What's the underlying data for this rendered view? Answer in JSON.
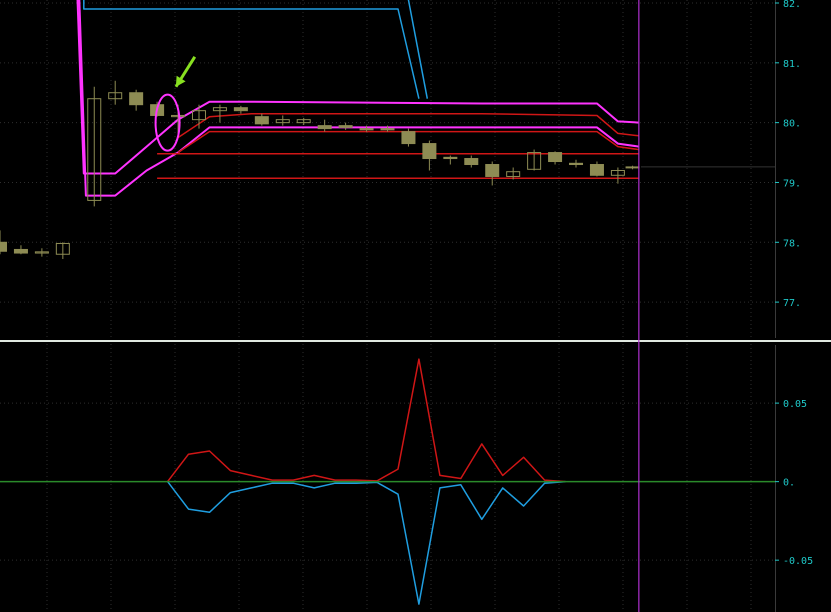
{
  "colors": {
    "background": "#000000",
    "grid": "#2e2e2e",
    "separator": "#e0e8e0",
    "axis_text": "#1fc9c9",
    "candle": "#8e8c54",
    "magenta": "#ff33ff",
    "red": "#d01616",
    "blue": "#1f9ee0",
    "zero_line": "#2a8a2a",
    "cursor": "#b030d0",
    "arrow": "#88e020",
    "ellipse": "#ff33ff"
  },
  "chart_data": [
    {
      "type": "candlestick",
      "panel": "price",
      "y_ticks": [
        "82.",
        "81.",
        "80.",
        "79.",
        "78.",
        "77."
      ],
      "y_tick_values": [
        82,
        81,
        80,
        79,
        78,
        77
      ],
      "ylim": [
        76.4,
        82.05
      ],
      "xlim": [
        0,
        37
      ],
      "candles": [
        {
          "x": 0,
          "o": 78.0,
          "h": 78.2,
          "l": 77.8,
          "c": 77.85
        },
        {
          "x": 1,
          "o": 77.88,
          "h": 77.95,
          "l": 77.8,
          "c": 77.82
        },
        {
          "x": 2,
          "o": 77.82,
          "h": 77.9,
          "l": 77.76,
          "c": 77.84
        },
        {
          "x": 3,
          "o": 77.8,
          "h": 78.0,
          "l": 77.72,
          "c": 77.98
        },
        {
          "x": 4.5,
          "o": 78.7,
          "h": 80.6,
          "l": 78.6,
          "c": 80.4
        },
        {
          "x": 5.5,
          "o": 80.4,
          "h": 80.7,
          "l": 80.3,
          "c": 80.5
        },
        {
          "x": 6.5,
          "o": 80.5,
          "h": 80.55,
          "l": 80.2,
          "c": 80.3
        },
        {
          "x": 7.5,
          "o": 80.3,
          "h": 80.35,
          "l": 80.1,
          "c": 80.12
        },
        {
          "x": 8.5,
          "o": 80.1,
          "h": 80.3,
          "l": 79.8,
          "c": 80.12
        },
        {
          "x": 9.5,
          "o": 80.05,
          "h": 80.3,
          "l": 79.9,
          "c": 80.2
        },
        {
          "x": 10.5,
          "o": 80.2,
          "h": 80.3,
          "l": 80.0,
          "c": 80.25
        },
        {
          "x": 11.5,
          "o": 80.25,
          "h": 80.28,
          "l": 80.15,
          "c": 80.2
        },
        {
          "x": 12.5,
          "o": 80.1,
          "h": 80.15,
          "l": 79.95,
          "c": 79.98
        },
        {
          "x": 13.5,
          "o": 80.0,
          "h": 80.12,
          "l": 79.95,
          "c": 80.05
        },
        {
          "x": 14.5,
          "o": 80.0,
          "h": 80.08,
          "l": 79.96,
          "c": 80.05
        },
        {
          "x": 15.5,
          "o": 79.95,
          "h": 80.05,
          "l": 79.85,
          "c": 79.9
        },
        {
          "x": 16.5,
          "o": 79.95,
          "h": 80.0,
          "l": 79.88,
          "c": 79.92
        },
        {
          "x": 17.5,
          "o": 79.9,
          "h": 79.95,
          "l": 79.85,
          "c": 79.88
        },
        {
          "x": 18.5,
          "o": 79.9,
          "h": 79.95,
          "l": 79.85,
          "c": 79.88
        },
        {
          "x": 19.5,
          "o": 79.85,
          "h": 79.9,
          "l": 79.6,
          "c": 79.65
        },
        {
          "x": 20.5,
          "o": 79.65,
          "h": 79.7,
          "l": 79.2,
          "c": 79.4
        },
        {
          "x": 21.5,
          "o": 79.42,
          "h": 79.45,
          "l": 79.3,
          "c": 79.4
        },
        {
          "x": 22.5,
          "o": 79.4,
          "h": 79.45,
          "l": 79.25,
          "c": 79.3
        },
        {
          "x": 23.5,
          "o": 79.3,
          "h": 79.35,
          "l": 78.95,
          "c": 79.1
        },
        {
          "x": 24.5,
          "o": 79.1,
          "h": 79.25,
          "l": 79.05,
          "c": 79.18
        },
        {
          "x": 25.5,
          "o": 79.22,
          "h": 79.55,
          "l": 79.2,
          "c": 79.5
        },
        {
          "x": 26.5,
          "o": 79.5,
          "h": 79.52,
          "l": 79.3,
          "c": 79.35
        },
        {
          "x": 27.5,
          "o": 79.32,
          "h": 79.38,
          "l": 79.25,
          "c": 79.3
        },
        {
          "x": 28.5,
          "o": 79.3,
          "h": 79.35,
          "l": 79.1,
          "c": 79.12
        },
        {
          "x": 29.5,
          "o": 79.12,
          "h": 79.25,
          "l": 78.98,
          "c": 79.2
        },
        {
          "x": 30.2,
          "o": 79.25,
          "h": 79.28,
          "l": 79.22,
          "c": 79.26
        }
      ],
      "series": [
        {
          "color_key": "magenta",
          "style": "band_top",
          "x": [
            -1,
            3.5,
            4.0,
            5.5,
            7.0,
            8.5,
            10.0,
            12.0,
            23.0,
            28.5,
            29.5,
            30.5
          ],
          "values": [
            88.0,
            84.0,
            79.15,
            79.15,
            79.6,
            80.05,
            80.35,
            80.35,
            80.32,
            80.32,
            80.02,
            80.0
          ]
        },
        {
          "color_key": "magenta",
          "style": "band_bottom",
          "x": [
            -1,
            3.6,
            4.1,
            5.5,
            7.0,
            8.5,
            10.0,
            12.0,
            28.5,
            29.5,
            30.5
          ],
          "values": [
            88.0,
            84.0,
            78.78,
            78.78,
            79.2,
            79.5,
            79.92,
            79.92,
            79.92,
            79.65,
            79.6
          ]
        },
        {
          "color_key": "red",
          "style": "inner",
          "x": [
            8.5,
            10.0,
            12.0,
            23.0,
            28.5,
            29.5,
            30.5
          ],
          "values": [
            79.75,
            80.1,
            80.15,
            80.15,
            80.12,
            79.82,
            79.78
          ]
        },
        {
          "color_key": "red",
          "style": "inner",
          "x": [
            8.5,
            10.0,
            12.0,
            28.5,
            29.5,
            30.5
          ],
          "values": [
            79.5,
            79.85,
            79.85,
            79.85,
            79.6,
            79.55
          ]
        },
        {
          "color_key": "red",
          "style": "flat",
          "x": [
            7.5,
            30.5
          ],
          "values": [
            79.48,
            79.48
          ]
        },
        {
          "color_key": "red",
          "style": "flat",
          "x": [
            7.5,
            30.5
          ],
          "values": [
            79.07,
            79.07
          ]
        },
        {
          "color_key": "blue",
          "style": "stop",
          "x": [
            4.0,
            4.0,
            19.0,
            20.0
          ],
          "values": [
            82.6,
            81.9,
            81.9,
            80.4
          ]
        },
        {
          "color_key": "blue",
          "style": "stop",
          "x": [
            19.2,
            20.4
          ],
          "values": [
            82.6,
            80.4
          ]
        }
      ],
      "marker": {
        "type": "ellipse",
        "x": 8.0,
        "y": 80.0
      },
      "arrow": {
        "from_x": 9.3,
        "from_y": 81.1,
        "to_x": 8.4,
        "to_y": 80.6
      },
      "cursor_x": 30.5,
      "last_price": 79.26
    },
    {
      "type": "line",
      "panel": "indicator",
      "y_ticks": [
        "0.05",
        "0.",
        "-0.05"
      ],
      "y_tick_values": [
        0.05,
        0,
        -0.05
      ],
      "ylim": [
        -0.083,
        0.087
      ],
      "xlim": [
        0,
        37
      ],
      "series": [
        {
          "color_key": "red",
          "x": [
            8.0,
            9.0,
            10.0,
            11.0,
            12.0,
            13.0,
            14.0,
            15.0,
            16.0,
            17.0,
            18.0,
            19.0,
            20.0,
            21.0,
            22.0,
            23.0,
            24.0,
            25.0,
            26.0,
            27.0
          ],
          "values": [
            0,
            0.0175,
            0.0195,
            0.007,
            0.004,
            0.001,
            0.001,
            0.004,
            0.001,
            0.001,
            0.0005,
            0.008,
            0.078,
            0.004,
            0.002,
            0.024,
            0.004,
            0.0155,
            0.001,
            0
          ]
        },
        {
          "color_key": "blue",
          "x": [
            8.0,
            9.0,
            10.0,
            11.0,
            12.0,
            13.0,
            14.0,
            15.0,
            16.0,
            17.0,
            18.0,
            19.0,
            20.0,
            21.0,
            22.0,
            23.0,
            24.0,
            25.0,
            26.0,
            27.0
          ],
          "values": [
            0,
            -0.0175,
            -0.0195,
            -0.007,
            -0.004,
            -0.001,
            -0.001,
            -0.004,
            -0.001,
            -0.001,
            -0.0005,
            -0.008,
            -0.078,
            -0.004,
            -0.002,
            -0.024,
            -0.004,
            -0.0155,
            -0.001,
            0
          ]
        },
        {
          "color_key": "zero_line",
          "x": [
            0,
            37
          ],
          "values": [
            0,
            0
          ]
        }
      ],
      "cursor_x": 30.5
    }
  ]
}
